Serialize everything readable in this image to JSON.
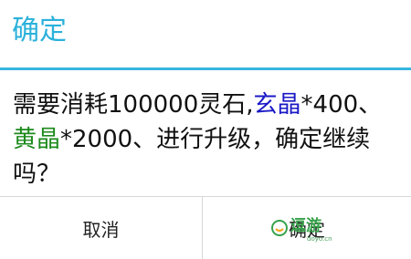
{
  "dialog": {
    "title": "确定",
    "message": {
      "part1": "需要消耗100000灵石,",
      "item1": "玄晶",
      "part2": "*400、",
      "item2": "黄晶",
      "part3": "*2000、进行升级，确定继续吗？"
    },
    "buttons": {
      "cancel_label": "取消",
      "confirm_label": "确定"
    }
  },
  "colors": {
    "title": "#2ab1db",
    "divider": "#35b6de",
    "item1": "#1a19c7",
    "item2": "#1d8a1d",
    "watermark": "#37a24a"
  },
  "watermark": {
    "logo": "逗游",
    "site": "doyo.cn",
    "icon": "smile-logo-icon"
  }
}
